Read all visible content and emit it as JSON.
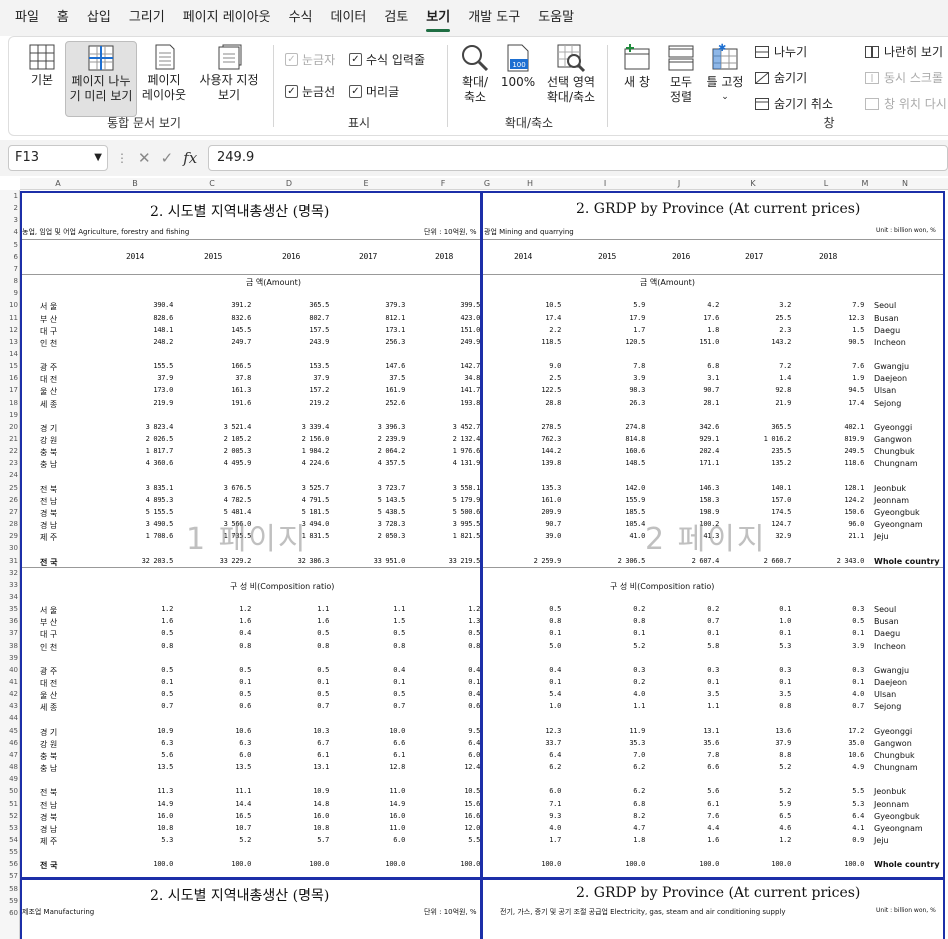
{
  "menu": [
    "파일",
    "홈",
    "삽입",
    "그리기",
    "페이지 레이아웃",
    "수식",
    "데이터",
    "검토",
    "보기",
    "개발 도구",
    "도움말"
  ],
  "menu_active_index": 8,
  "ribbon": {
    "views": {
      "normal": "기본",
      "page_break_l1": "페이지 나누",
      "page_break_l2": "기 미리 보기",
      "page_layout_l1": "페이지",
      "page_layout_l2": "레이아웃",
      "custom_l1": "사용자 지정",
      "custom_l2": "보기",
      "group": "통합 문서 보기"
    },
    "show": {
      "ruler": "눈금자",
      "formula_bar": "수식 입력줄",
      "gridlines": "눈금선",
      "headings": "머리글",
      "group": "표시"
    },
    "zoom": {
      "zoom_l1": "확대/",
      "zoom_l2": "축소",
      "hundred": "100%",
      "sel_l1": "선택 영역",
      "sel_l2": "확대/축소",
      "group": "확대/축소"
    },
    "window": {
      "new_window": "새 창",
      "arrange_l1": "모두",
      "arrange_l2": "정렬",
      "freeze": "틀 고정",
      "split": "나누기",
      "hide": "숨기기",
      "unhide": "숨기기 취소",
      "side_by_side": "나란히 보기",
      "sync_scroll": "동시 스크롤",
      "reset_pos": "창 위치 다시",
      "group": "창"
    }
  },
  "formula_bar": {
    "name_box": "F13",
    "fx": "fx",
    "value": "249.9"
  },
  "columns": [
    "A",
    "B",
    "C",
    "D",
    "E",
    "F",
    "G",
    "H",
    "I",
    "J",
    "K",
    "L",
    "M",
    "N"
  ],
  "rows": [
    "1",
    "2",
    "3",
    "4",
    "5",
    "6",
    "7",
    "8",
    "9",
    "10",
    "11",
    "12",
    "13",
    "14",
    "15",
    "16",
    "17",
    "18",
    "19",
    "20",
    "21",
    "22",
    "23",
    "24",
    "25",
    "26",
    "27",
    "28",
    "29",
    "30",
    "31",
    "32",
    "33",
    "34",
    "35",
    "36",
    "37",
    "38",
    "39",
    "40",
    "41",
    "42",
    "43",
    "44",
    "45",
    "46",
    "47",
    "48",
    "49",
    "50",
    "51",
    "52",
    "53",
    "54",
    "55",
    "56",
    "57",
    "58",
    "59",
    "60"
  ],
  "left_page": {
    "title": "2. 시도별 지역내총생산 (명목)",
    "sector": "농업, 임업 및 어업  Agriculture, forestry and fishing",
    "unit": "단위 : 10억원, %",
    "years": [
      "2014",
      "2015",
      "2016",
      "2017",
      "2018"
    ],
    "amount_hdr": "금        액(Amount)",
    "ratio_hdr": "구    성    비(Composition ratio)",
    "watermark": "1 페이지",
    "footer_title": "2. 시도별 지역내총생산 (명목)",
    "footer_sector": "제조업  Manufacturing",
    "footer_unit": "단위 : 10억원, %"
  },
  "right_page": {
    "title": "2. GRDP by Province (At current prices)",
    "sector": "광업  Mining and quarrying",
    "unit": "Unit : billion won, %",
    "amount_hdr": "금        액(Amount)",
    "ratio_hdr": "구    성    비(Composition ratio)",
    "watermark": "2 페이지",
    "footer_title": "2. GRDP by Province (At current prices)",
    "footer_sector": "전기, 가스, 증기 및 공기 조절 공급업  Electricity, gas, steam and air conditioning supply",
    "footer_unit": "Unit : billion won, %"
  },
  "provinces_kr": [
    "서  울",
    "부  산",
    "대  구",
    "인  천",
    "광  주",
    "대  전",
    "울  산",
    "세  종",
    "경  기",
    "강  원",
    "충  북",
    "충  남",
    "전  북",
    "전  남",
    "경  북",
    "경  남",
    "제  주",
    "전  국"
  ],
  "provinces_en": [
    "Seoul",
    "Busan",
    "Daegu",
    "Incheon",
    "Gwangju",
    "Daejeon",
    "Ulsan",
    "Sejong",
    "Gyeonggi",
    "Gangwon",
    "Chungbuk",
    "Chungnam",
    "Jeonbuk",
    "Jeonnam",
    "Gyeongbuk",
    "Gyeongnam",
    "Jeju",
    "Whole country"
  ],
  "amount_left": [
    [
      "390.4",
      "391.2",
      "365.5",
      "379.3",
      "399.5"
    ],
    [
      "828.6",
      "832.6",
      "802.7",
      "812.1",
      "423.0"
    ],
    [
      "148.1",
      "145.5",
      "157.5",
      "173.1",
      "151.0"
    ],
    [
      "248.2",
      "249.7",
      "243.9",
      "256.3",
      "249.9"
    ],
    [
      "155.5",
      "166.5",
      "153.5",
      "147.6",
      "142.7"
    ],
    [
      "37.9",
      "37.8",
      "37.9",
      "37.5",
      "34.8"
    ],
    [
      "173.0",
      "161.3",
      "157.2",
      "161.9",
      "141.7"
    ],
    [
      "219.9",
      "191.6",
      "219.2",
      "252.6",
      "193.8"
    ],
    [
      "3 823.4",
      "3 521.4",
      "3 339.4",
      "3 396.3",
      "3 452.7"
    ],
    [
      "2 026.5",
      "2 105.2",
      "2 156.0",
      "2 239.9",
      "2 132.4"
    ],
    [
      "1 817.7",
      "2 005.3",
      "1 984.2",
      "2 064.2",
      "1 976.6"
    ],
    [
      "4 360.6",
      "4 495.9",
      "4 224.6",
      "4 357.5",
      "4 131.9"
    ],
    [
      "3 835.1",
      "3 676.5",
      "3 525.7",
      "3 723.7",
      "3 558.1"
    ],
    [
      "4 895.3",
      "4 782.5",
      "4 791.5",
      "5 143.5",
      "5 179.9"
    ],
    [
      "5 155.5",
      "5 481.4",
      "5 181.5",
      "5 438.5",
      "5 500.6"
    ],
    [
      "3 490.5",
      "3 566.0",
      "3 494.0",
      "3 728.3",
      "3 995.5"
    ],
    [
      "1 708.6",
      "1 735.5",
      "1 831.5",
      "2 050.3",
      "1 821.5"
    ],
    [
      "32 203.5",
      "33 229.2",
      "32 386.3",
      "33 951.0",
      "33 219.5"
    ]
  ],
  "amount_right": [
    [
      "10.5",
      "5.9",
      "4.2",
      "3.2",
      "7.9"
    ],
    [
      "17.4",
      "17.9",
      "17.6",
      "25.5",
      "12.3"
    ],
    [
      "2.2",
      "1.7",
      "1.8",
      "2.3",
      "1.5"
    ],
    [
      "118.5",
      "120.5",
      "151.0",
      "143.2",
      "90.5"
    ],
    [
      "9.0",
      "7.8",
      "6.8",
      "7.2",
      "7.6"
    ],
    [
      "2.5",
      "3.9",
      "3.1",
      "1.4",
      "1.9"
    ],
    [
      "122.5",
      "98.3",
      "90.7",
      "92.8",
      "94.5"
    ],
    [
      "28.8",
      "26.3",
      "28.1",
      "21.9",
      "17.4"
    ],
    [
      "278.5",
      "274.8",
      "342.6",
      "365.5",
      "402.1"
    ],
    [
      "762.3",
      "814.8",
      "929.1",
      "1 016.2",
      "819.9"
    ],
    [
      "144.2",
      "160.6",
      "202.4",
      "235.5",
      "249.5"
    ],
    [
      "139.8",
      "148.5",
      "171.1",
      "135.2",
      "118.6"
    ],
    [
      "135.3",
      "142.0",
      "146.3",
      "140.1",
      "128.1"
    ],
    [
      "161.0",
      "155.9",
      "158.3",
      "157.0",
      "124.2"
    ],
    [
      "209.9",
      "185.5",
      "198.9",
      "174.5",
      "150.6"
    ],
    [
      "90.7",
      "105.4",
      "100.2",
      "124.7",
      "96.0"
    ],
    [
      "39.0",
      "41.0",
      "41.3",
      "32.9",
      "21.1"
    ],
    [
      "2 259.9",
      "2 306.5",
      "2 607.4",
      "2 660.7",
      "2 343.0"
    ]
  ],
  "ratio_left": [
    [
      "1.2",
      "1.2",
      "1.1",
      "1.1",
      "1.2"
    ],
    [
      "1.6",
      "1.6",
      "1.6",
      "1.5",
      "1.3"
    ],
    [
      "0.5",
      "0.4",
      "0.5",
      "0.5",
      "0.5"
    ],
    [
      "0.8",
      "0.8",
      "0.8",
      "0.8",
      "0.8"
    ],
    [
      "0.5",
      "0.5",
      "0.5",
      "0.4",
      "0.4"
    ],
    [
      "0.1",
      "0.1",
      "0.1",
      "0.1",
      "0.1"
    ],
    [
      "0.5",
      "0.5",
      "0.5",
      "0.5",
      "0.4"
    ],
    [
      "0.7",
      "0.6",
      "0.7",
      "0.7",
      "0.6"
    ],
    [
      "10.9",
      "10.6",
      "10.3",
      "10.0",
      "9.5"
    ],
    [
      "6.3",
      "6.3",
      "6.7",
      "6.6",
      "6.4"
    ],
    [
      "5.6",
      "6.0",
      "6.1",
      "6.1",
      "6.0"
    ],
    [
      "13.5",
      "13.5",
      "13.1",
      "12.8",
      "12.4"
    ],
    [
      "11.3",
      "11.1",
      "10.9",
      "11.0",
      "10.5"
    ],
    [
      "14.9",
      "14.4",
      "14.8",
      "14.9",
      "15.6"
    ],
    [
      "16.0",
      "16.5",
      "16.0",
      "16.0",
      "16.6"
    ],
    [
      "10.8",
      "10.7",
      "10.8",
      "11.0",
      "12.0"
    ],
    [
      "5.3",
      "5.2",
      "5.7",
      "6.0",
      "5.5"
    ],
    [
      "100.0",
      "100.0",
      "100.0",
      "100.0",
      "100.0"
    ]
  ],
  "ratio_right": [
    [
      "0.5",
      "0.2",
      "0.2",
      "0.1",
      "0.3"
    ],
    [
      "0.8",
      "0.8",
      "0.7",
      "1.0",
      "0.5"
    ],
    [
      "0.1",
      "0.1",
      "0.1",
      "0.1",
      "0.1"
    ],
    [
      "5.0",
      "5.2",
      "5.8",
      "5.3",
      "3.9"
    ],
    [
      "0.4",
      "0.3",
      "0.3",
      "0.3",
      "0.3"
    ],
    [
      "0.1",
      "0.2",
      "0.1",
      "0.1",
      "0.1"
    ],
    [
      "5.4",
      "4.0",
      "3.5",
      "3.5",
      "4.0"
    ],
    [
      "1.0",
      "1.1",
      "1.1",
      "0.8",
      "0.7"
    ],
    [
      "12.3",
      "11.9",
      "13.1",
      "13.6",
      "17.2"
    ],
    [
      "33.7",
      "35.3",
      "35.6",
      "37.9",
      "35.0"
    ],
    [
      "6.4",
      "7.0",
      "7.8",
      "8.8",
      "10.6"
    ],
    [
      "6.2",
      "6.2",
      "6.6",
      "5.2",
      "4.9"
    ],
    [
      "6.0",
      "6.2",
      "5.6",
      "5.2",
      "5.5"
    ],
    [
      "7.1",
      "6.8",
      "6.1",
      "5.9",
      "5.3"
    ],
    [
      "9.3",
      "8.2",
      "7.6",
      "6.5",
      "6.4"
    ],
    [
      "4.0",
      "4.7",
      "4.4",
      "4.6",
      "4.1"
    ],
    [
      "1.7",
      "1.8",
      "1.6",
      "1.2",
      "0.9"
    ],
    [
      "100.0",
      "100.0",
      "100.0",
      "100.0",
      "100.0"
    ]
  ]
}
